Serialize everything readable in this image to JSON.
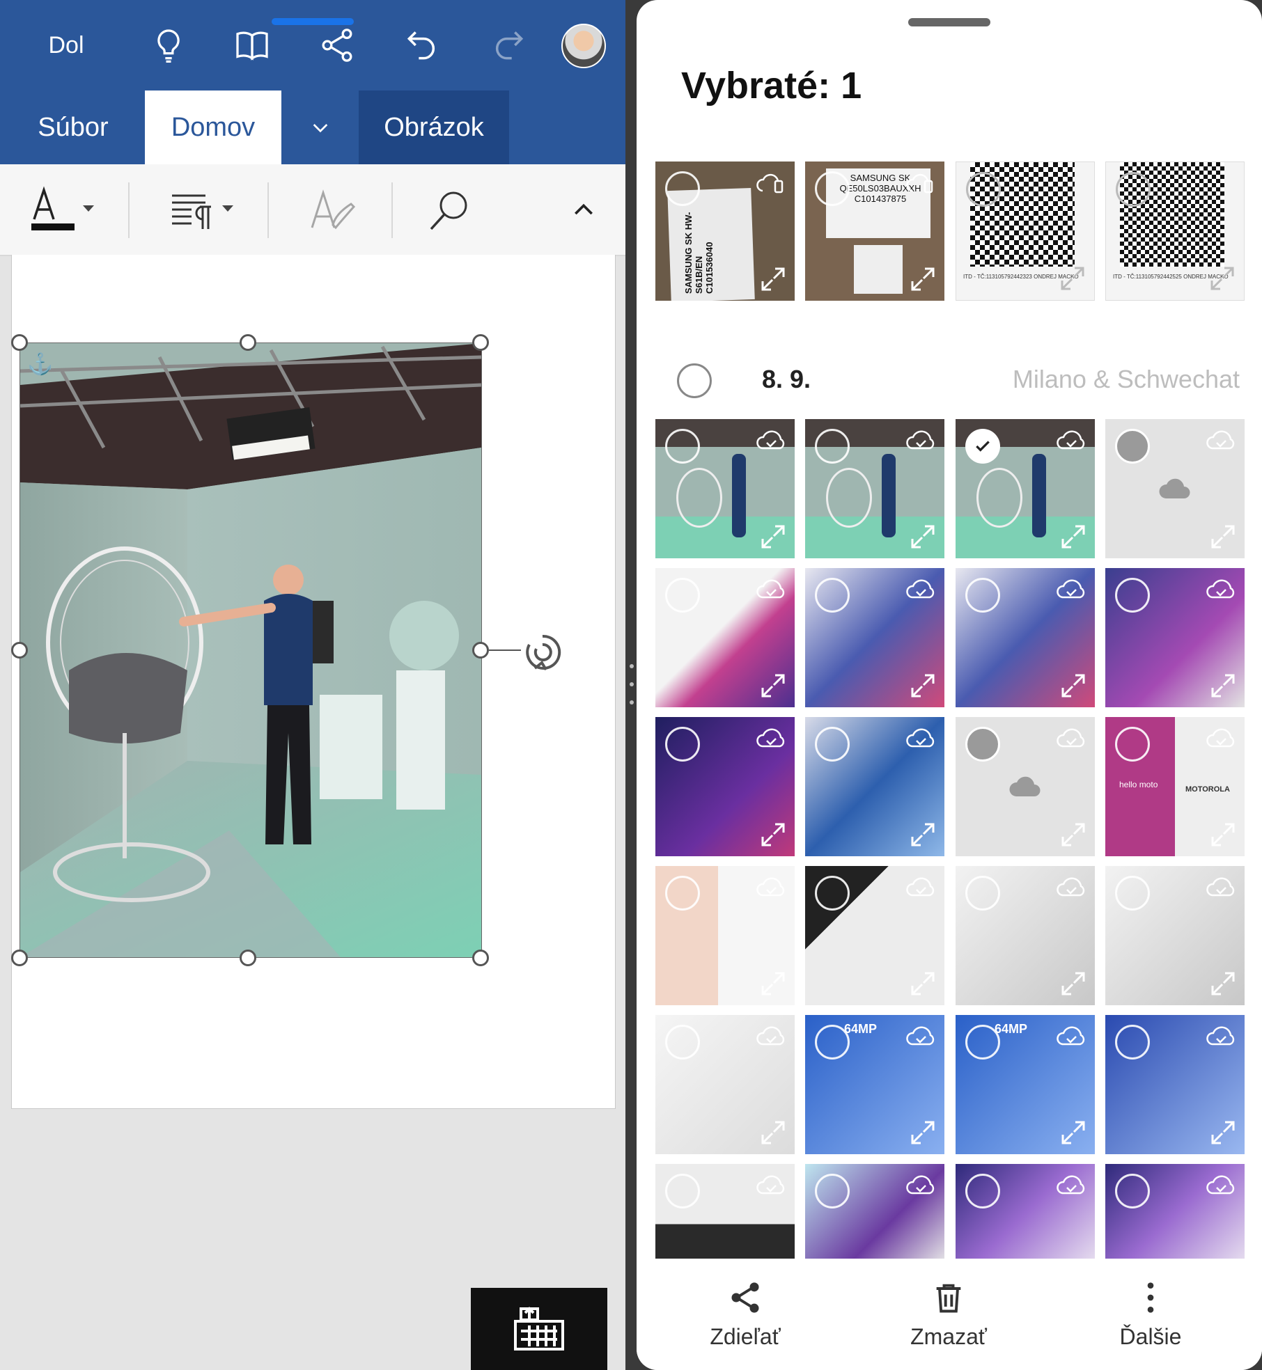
{
  "word": {
    "quick_access": {
      "dol_label": "Dol",
      "icons": [
        "lightbulb-icon",
        "book-icon",
        "share-icon",
        "undo-icon",
        "redo-icon"
      ]
    },
    "tabs": [
      {
        "label": "Súbor"
      },
      {
        "label": "Domov"
      },
      {
        "label": "Obrázok"
      }
    ],
    "toolbar_icons": [
      "font-color-icon",
      "paragraph-icon",
      "styles-icon",
      "search-icon",
      "collapse-icon"
    ],
    "colors": {
      "ribbon": "#2b579a",
      "active_tab_text": "#2b579a",
      "contextual_tab": "#1f4684"
    }
  },
  "gallery": {
    "selected_title": "Vybraté: 1",
    "section": {
      "date": "8. 9.",
      "place": "Milano & Schwechat"
    },
    "bottom_actions": [
      {
        "label": "Zdieľať",
        "icon": "share-icon"
      },
      {
        "label": "Zmazať",
        "icon": "trash-icon"
      },
      {
        "label": "Ďalšie",
        "icon": "more-vertical-icon"
      }
    ],
    "top_row": [
      {
        "kind": "box",
        "text": "SAMSUNG SK HW-S61B/EN C101536040"
      },
      {
        "kind": "box",
        "text": "SAMSUNG SK QE50LS03BAUXXH C101437875"
      },
      {
        "kind": "qr",
        "text": "ITD - TČ:113105792442323 ONDREJ MACKO"
      },
      {
        "kind": "qr",
        "text": "ITD - TČ:113105792442525 ONDREJ MACKO"
      }
    ],
    "grid": [
      [
        "booth",
        "booth",
        "booth-selected",
        "placeholder"
      ],
      [
        "slide-pink",
        "slide-phones",
        "slide-phones",
        "slide-purple"
      ],
      [
        "slide-security",
        "slide-blue",
        "placeholder",
        "slide-hellomoto"
      ],
      [
        "slide-design",
        "slide-ux",
        "slide-gray",
        "slide-gray"
      ],
      [
        "slide-product",
        "slide-64mp",
        "slide-64mp",
        "slide-lightblue"
      ],
      [
        "slide-audio",
        "slide-entertainment",
        "slide-handphone",
        "slide-handphone"
      ]
    ],
    "thumb_texts": {
      "hello_moto": "hello moto",
      "motorola": "MOTOROLA",
      "mp64": "64MP"
    }
  }
}
